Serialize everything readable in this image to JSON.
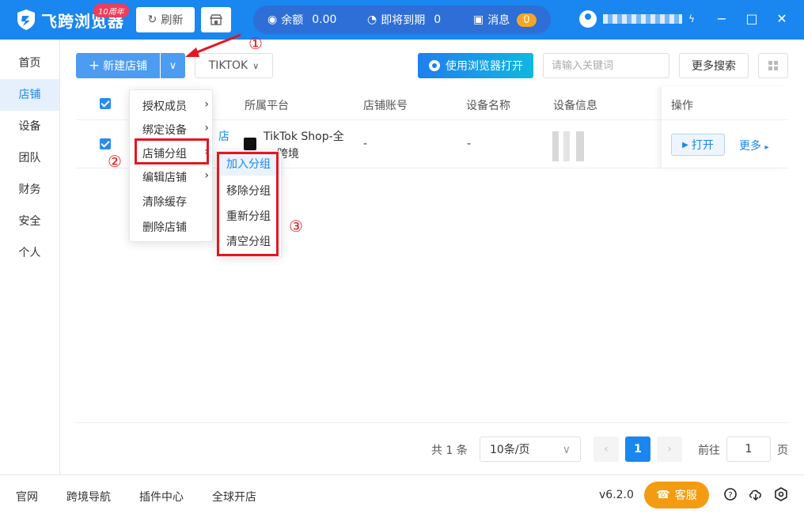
{
  "header": {
    "logo_text": "飞跨浏览器",
    "anniversary_badge": "10周年",
    "refresh_label": "刷新",
    "balance_label": "余额",
    "balance_value": "0.00",
    "expiring_label": "即将到期",
    "expiring_value": "0",
    "messages_label": "消息",
    "messages_count": "0"
  },
  "sidebar": {
    "items": [
      "首页",
      "店铺",
      "设备",
      "团队",
      "财务",
      "安全",
      "个人"
    ],
    "active": "店铺"
  },
  "toolbar": {
    "new_shop_label": "新建店铺",
    "platform_filter": "TIKTOK",
    "open_browser_label": "使用浏览器打开",
    "search_placeholder": "请输入关键词",
    "more_search_label": "更多搜索"
  },
  "table": {
    "columns": [
      "所属平台",
      "店铺账号",
      "设备名称",
      "设备信息",
      "操作"
    ],
    "rows": [
      {
        "platform": "TikTok Shop-全",
        "platform_line2": "跨境",
        "account": "-",
        "device_name": "-",
        "open_label": "打开",
        "more_label": "更多"
      }
    ]
  },
  "dropdown_menu": {
    "items": [
      {
        "label": "授权成员",
        "has_sub": true
      },
      {
        "label": "绑定设备",
        "has_sub": true
      },
      {
        "label": "店铺分组",
        "has_sub": true
      },
      {
        "label": "编辑店铺",
        "has_sub": true
      },
      {
        "label": "清除缓存",
        "has_sub": false
      },
      {
        "label": "删除店铺",
        "has_sub": false
      }
    ]
  },
  "group_submenu": {
    "items": [
      "加入分组",
      "移除分组",
      "重新分组",
      "清空分组"
    ],
    "highlighted": "加入分组"
  },
  "annotations": [
    "①",
    "②",
    "③"
  ],
  "pagination": {
    "total_text": "共 1 条",
    "page_size": "10条/页",
    "current_page": "1",
    "goto_label": "前往",
    "goto_value": "1",
    "page_suffix": "页"
  },
  "footer": {
    "links": [
      "官网",
      "跨境导航",
      "插件中心",
      "全球开店"
    ],
    "version": "v6.2.0",
    "service_label": "客服"
  },
  "colors": {
    "primary": "#1a86f0",
    "annotation_red": "#e5161f",
    "service_orange": "#f39c12"
  }
}
